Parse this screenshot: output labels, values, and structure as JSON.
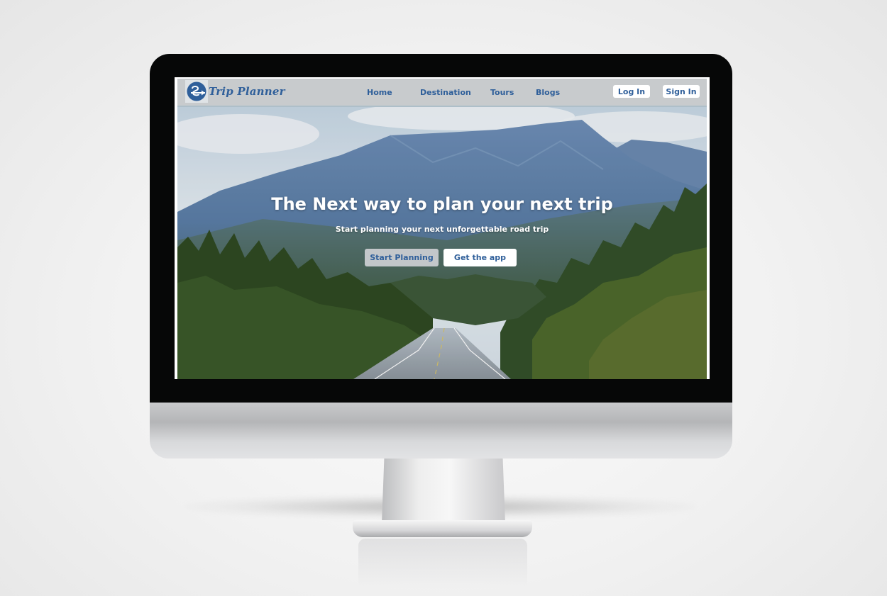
{
  "brand": {
    "name": "Trip Planner",
    "logo_icon": "circle-arrow-logo-icon",
    "color": "#2f5f9a"
  },
  "nav": {
    "links": [
      "Home",
      "Destination",
      "Tours",
      "Blogs"
    ],
    "login_label": "Log In",
    "signin_label": "Sign In"
  },
  "hero": {
    "title": "The Next way to plan your next trip",
    "subtitle": "Start planning your next unforgettable road trip",
    "primary_cta": "Start Planning",
    "secondary_cta": "Get the app",
    "image": "mountain-road-forest-photo"
  },
  "colors": {
    "navbar_bg": "#c8cbcd",
    "accent": "#2f5f9a",
    "bezel": "#060707"
  }
}
